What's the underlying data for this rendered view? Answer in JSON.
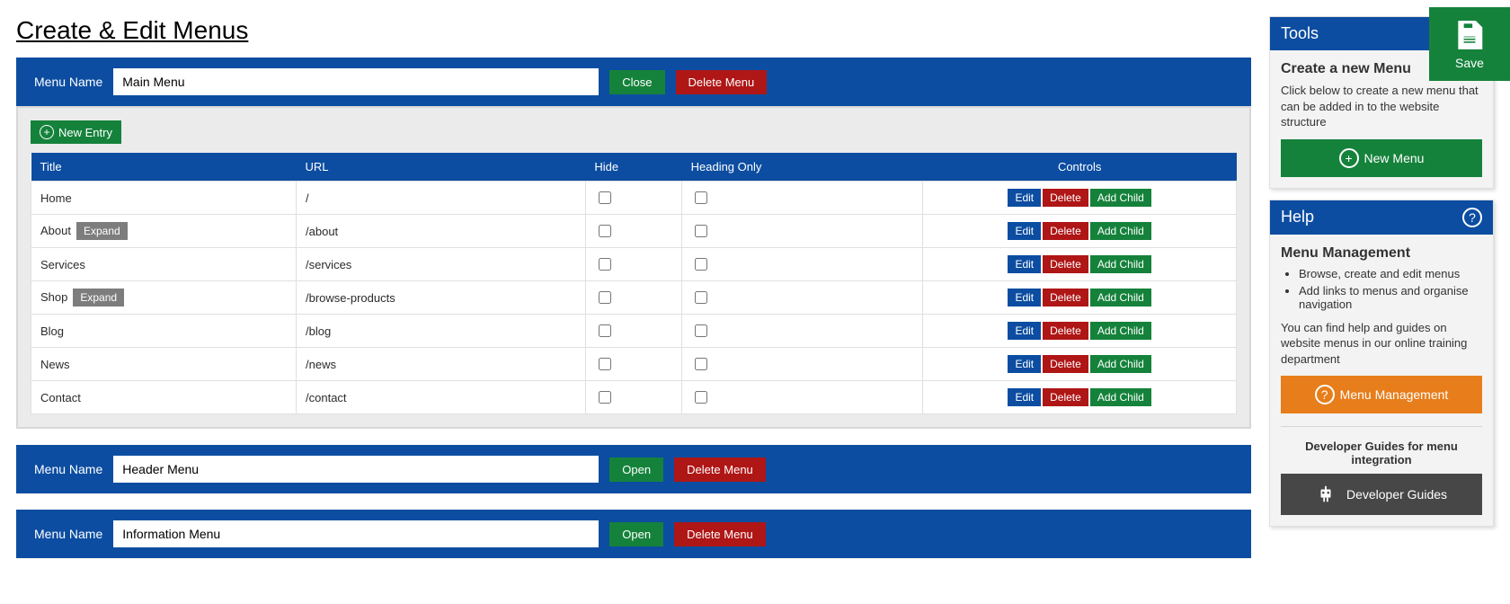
{
  "page_title": "Create & Edit Menus",
  "save_label": "Save",
  "labels": {
    "menu_name": "Menu Name",
    "close": "Close",
    "open": "Open",
    "delete_menu": "Delete Menu",
    "new_entry": "New Entry",
    "edit": "Edit",
    "delete": "Delete",
    "add_child": "Add Child",
    "expand": "Expand"
  },
  "table_headers": {
    "title": "Title",
    "url": "URL",
    "hide": "Hide",
    "heading_only": "Heading Only",
    "controls": "Controls"
  },
  "menus": [
    {
      "name": "Main Menu",
      "open": true,
      "entries": [
        {
          "title": "Home",
          "url": "/",
          "hide": false,
          "heading_only": false,
          "has_children": false
        },
        {
          "title": "About",
          "url": "/about",
          "hide": false,
          "heading_only": false,
          "has_children": true
        },
        {
          "title": "Services",
          "url": "/services",
          "hide": false,
          "heading_only": false,
          "has_children": false
        },
        {
          "title": "Shop",
          "url": "/browse-products",
          "hide": false,
          "heading_only": false,
          "has_children": true
        },
        {
          "title": "Blog",
          "url": "/blog",
          "hide": false,
          "heading_only": false,
          "has_children": false
        },
        {
          "title": "News",
          "url": "/news",
          "hide": false,
          "heading_only": false,
          "has_children": false
        },
        {
          "title": "Contact",
          "url": "/contact",
          "hide": false,
          "heading_only": false,
          "has_children": false
        }
      ]
    },
    {
      "name": "Header Menu",
      "open": false
    },
    {
      "name": "Information Menu",
      "open": false
    }
  ],
  "tools": {
    "title": "Tools",
    "create_heading": "Create a new Menu",
    "create_text": "Click below to create a new menu that can be added in to the website structure",
    "new_menu_label": "New Menu"
  },
  "help": {
    "title": "Help",
    "heading": "Menu Management",
    "bullets": [
      "Browse, create and edit menus",
      "Add links to menus and organise navigation"
    ],
    "text": "You can find help and guides on website menus in our online training department",
    "menu_mgmt_label": "Menu Management",
    "dev_guides_heading": "Developer Guides for menu integration",
    "dev_guides_label": "Developer Guides"
  }
}
